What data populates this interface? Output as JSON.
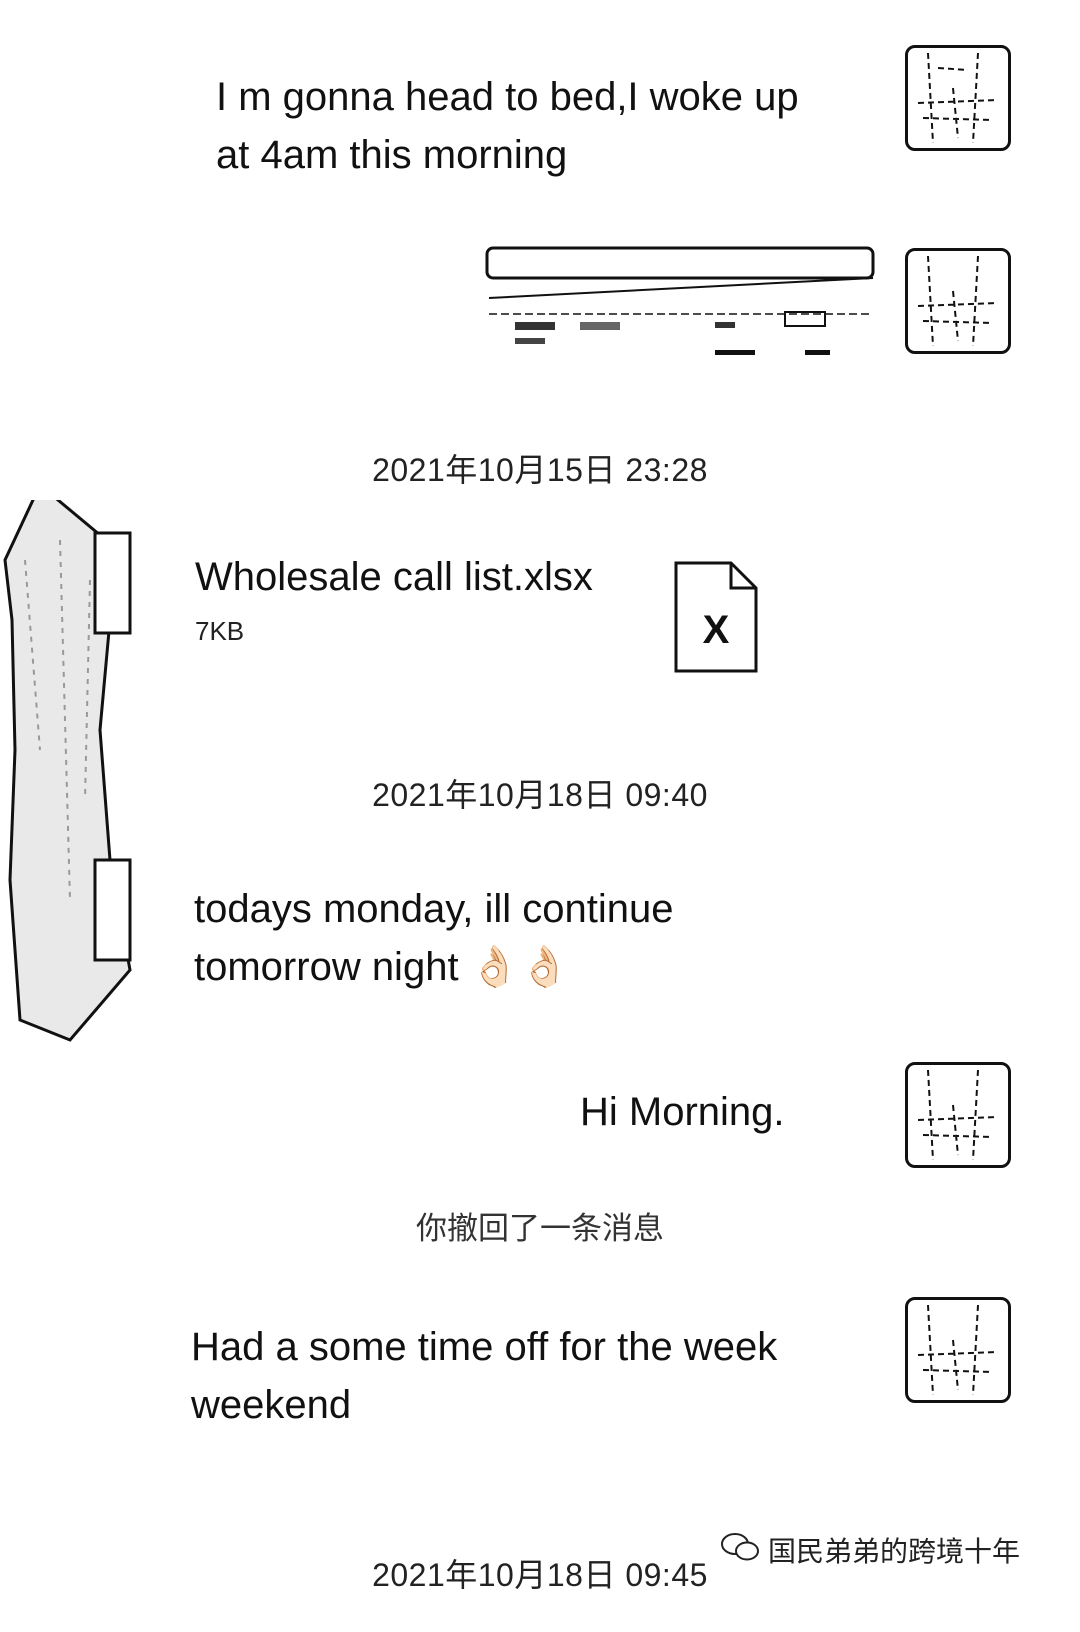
{
  "messages": [
    {
      "id": "m1",
      "side": "right",
      "type": "text",
      "lines": [
        "I m gonna head to bed,I woke up",
        "at 4am this morning"
      ]
    },
    {
      "id": "m2",
      "side": "right",
      "type": "image"
    },
    {
      "id": "m3",
      "side": "left",
      "type": "file",
      "file_name": "Wholesale call list.xlsx",
      "file_size": "7KB",
      "file_icon_label": "X"
    },
    {
      "id": "m4",
      "side": "left",
      "type": "text",
      "lines": [
        "todays monday, ill continue",
        "tomorrow night 👌🏻👌🏻"
      ]
    },
    {
      "id": "m5",
      "side": "right",
      "type": "text",
      "lines": [
        "Hi Morning."
      ]
    },
    {
      "id": "m6",
      "side": "right",
      "type": "text",
      "lines": [
        "Had a some time  off for the week",
        "weekend"
      ]
    }
  ],
  "timestamps": [
    "2021年10月15日 23:28",
    "2021年10月18日 09:40",
    "2021年10月18日 09:45"
  ],
  "system_note": "你撤回了一条消息",
  "watermark": {
    "icon": "wechat-icon",
    "text": "国民弟弟的跨境十年"
  }
}
